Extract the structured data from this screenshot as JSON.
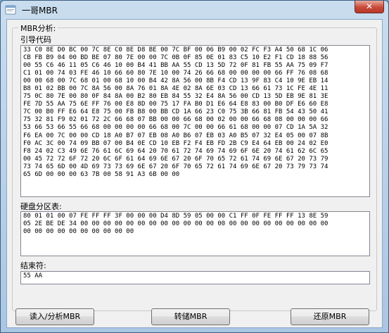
{
  "window": {
    "title": "一哥MBR",
    "close_glyph": "✕"
  },
  "group": {
    "legend": "MBR分析:"
  },
  "boot_code": {
    "label": "引导代码",
    "text": "33 C0 8E D0 BC 00 7C 8E C0 8E D8 BE 00 7C BF 00 06 B9 00 02 FC F3 A4 50 68 1C 06\nCB FB B9 04 00 BD BE 07 80 7E 00 00 7C 0B 0F 85 0E 01 83 C5 10 E2 F1 CD 18 88 56\n00 55 C6 46 11 05 C6 46 10 00 B4 41 BB AA 55 CD 13 5D 72 0F 81 FB 55 AA 75 09 F7\nC1 01 00 74 03 FE 46 10 66 60 80 7E 10 00 74 26 66 68 00 00 00 00 66 FF 76 08 68\n00 00 68 00 7C 68 01 00 68 10 00 B4 42 8A 56 00 8B F4 CD 13 9F 83 C4 10 9E EB 14\nB8 01 02 BB 00 7C 8A 56 00 8A 76 01 8A 4E 02 8A 6E 03 CD 13 66 61 73 1C FE 4E 11\n75 0C 80 7E 00 80 0F 84 8A 00 B2 80 EB 84 55 32 E4 8A 56 00 CD 13 5D EB 9E 81 3E\nFE 7D 55 AA 75 6E FF 76 00 E8 8D 00 75 17 FA B0 D1 E6 64 E8 83 00 B0 DF E6 60 E8\n7C 00 B0 FF E6 64 E8 75 00 FB B8 00 BB CD 1A 66 23 C0 75 3B 66 81 FB 54 43 50 41\n75 32 81 F9 02 01 72 2C 66 68 07 BB 00 00 66 68 00 02 00 00 66 68 08 00 00 00 66\n53 66 53 66 55 66 68 00 00 00 00 66 68 00 7C 00 00 66 61 68 00 00 07 CD 1A 5A 32\nF6 EA 00 7C 00 00 CD 18 A0 B7 07 EB 08 A0 B6 07 EB 03 A0 B5 07 32 E4 05 00 07 8B\nF0 AC 3C 00 74 09 BB 07 00 B4 0E CD 10 EB F2 F4 EB FD 2B C9 E4 64 EB 00 24 02 E0\nF8 24 02 C3 49 6E 76 61 6C 69 64 20 70 61 72 74 69 74 69 6F 6E 20 74 61 62 6C 65\n00 45 72 72 6F 72 20 6C 6F 61 64 69 6E 67 20 6F 70 65 72 61 74 69 6E 67 20 73 79\n73 74 65 6D 00 4D 69 73 73 69 6E 67 20 6F 70 65 72 61 74 69 6E 67 20 73 79 73 74\n65 6D 00 00 00 63 7B 00 58 91 A3 6B 00 00"
  },
  "partition_table": {
    "label": "硬盘分区表:",
    "text": "80 01 01 00 07 FE FF FF 3F 00 00 00 D4 8D 59 05 00 00 C1 FF 0F FE FF FF 13 8E 59\n05 2E BE DE 34 00 00 00 00 00 00 00 00 00 00 00 00 00 00 00 00 00 00 00 00 00 00\n00 00 00 00 00 00 00 00 00 00"
  },
  "end_marker": {
    "label": "结束符:",
    "text": "55 AA"
  },
  "buttons": {
    "read": "读入/分析MBR",
    "dump": "转储MBR",
    "restore": "还原MBR"
  },
  "colors": {
    "titlebar": "#b5d0ea",
    "close_button": "#c74a38",
    "client": "#f0f0f0"
  }
}
